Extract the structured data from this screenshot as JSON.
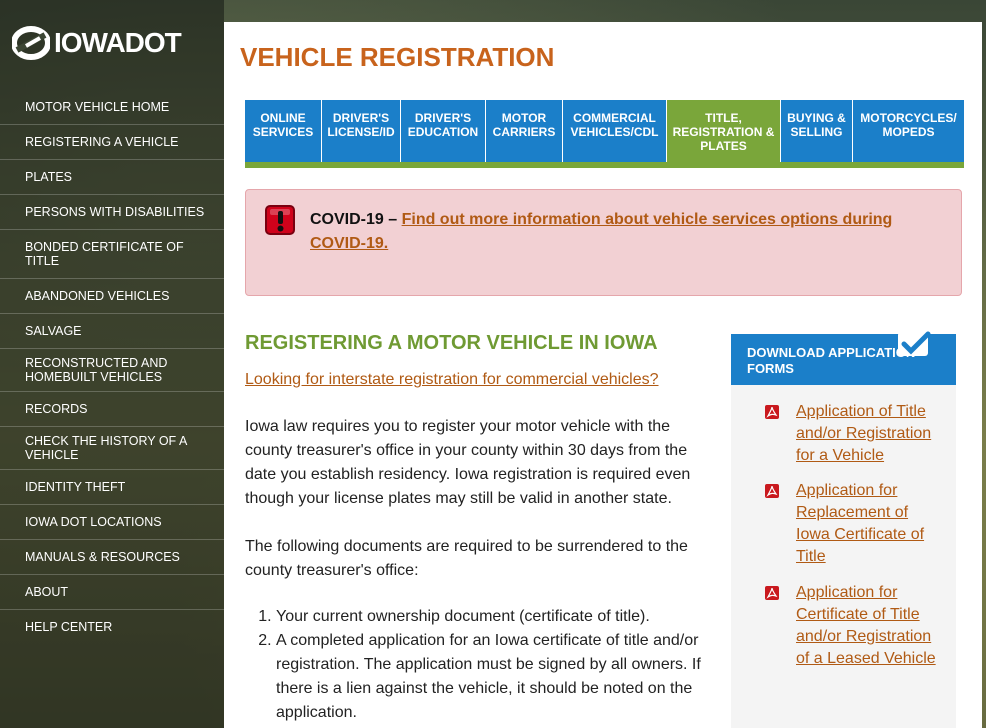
{
  "brand": {
    "logo_text": "IOWADOT",
    "logo_icon": "iowa-dot-logo-icon"
  },
  "sidebar": {
    "items": [
      {
        "label": "MOTOR VEHICLE HOME"
      },
      {
        "label": "REGISTERING A VEHICLE"
      },
      {
        "label": "PLATES"
      },
      {
        "label": "PERSONS WITH DISABILITIES"
      },
      {
        "label": "BONDED CERTIFICATE OF TITLE"
      },
      {
        "label": "ABANDONED VEHICLES"
      },
      {
        "label": "SALVAGE"
      },
      {
        "label": "RECONSTRUCTED AND HOMEBUILT VEHICLES"
      },
      {
        "label": "RECORDS"
      },
      {
        "label": "CHECK THE HISTORY OF A VEHICLE"
      },
      {
        "label": "IDENTITY THEFT"
      },
      {
        "label": "IOWA DOT LOCATIONS"
      },
      {
        "label": "MANUALS & RESOURCES"
      },
      {
        "label": "ABOUT"
      },
      {
        "label": "HELP CENTER"
      }
    ]
  },
  "main": {
    "page_title": "VEHICLE REGISTRATION",
    "tabs": [
      {
        "label": "ONLINE SERVICES",
        "active": false
      },
      {
        "label": "DRIVER'S LICENSE/ID",
        "active": false
      },
      {
        "label": "DRIVER'S EDUCATION",
        "active": false
      },
      {
        "label": "MOTOR CARRIERS",
        "active": false
      },
      {
        "label": "COMMERCIAL VEHICLES/CDL",
        "active": false
      },
      {
        "label": "TITLE, REGISTRATION & PLATES",
        "active": true
      },
      {
        "label": "BUYING & SELLING",
        "active": false
      },
      {
        "label": "MOTORCYCLES/ MOPEDS",
        "active": false
      }
    ],
    "alert": {
      "icon": "alert-exclamation-icon",
      "prefix": "COVID-19 – ",
      "link_text": "Find out more information about vehicle services options during COVID-19."
    },
    "section": {
      "heading": "REGISTERING A MOTOR VEHICLE IN IOWA",
      "interstate_link": "Looking for interstate registration for commercial vehicles?",
      "paragraph1": "Iowa law requires you to register your motor vehicle with the county treasurer's office in your county within 30 days from the date you establish residency. Iowa registration is required even though your license plates may still be valid in another state.",
      "paragraph2": "The following documents are required to be surrendered to the county treasurer's office:",
      "documents": [
        "Your current ownership document (certificate of title).",
        "A completed application for an Iowa certificate of title and/or registration. The application must be signed by all owners. If there is a lien against the vehicle, it should be noted on the application."
      ]
    },
    "forms_box": {
      "header": "DOWNLOAD APPLICATION FORMS",
      "header_icon": "checkmark-icon",
      "items": [
        {
          "label": "Application of Title and/or Registration for a Vehicle",
          "icon": "pdf-icon"
        },
        {
          "label": "Application for Replacement of Iowa Certificate of Title",
          "icon": "pdf-icon"
        },
        {
          "label": "Application for Certificate of Title and/or Registration of a Leased Vehicle",
          "icon": "pdf-icon"
        }
      ]
    }
  },
  "colors": {
    "title_orange": "#c8631c",
    "link_brown": "#b05a14",
    "tab_blue": "#1b7fc9",
    "tab_green": "#7aa63a",
    "heading_green": "#6f9a33",
    "alert_bg": "#f2d0d3"
  }
}
